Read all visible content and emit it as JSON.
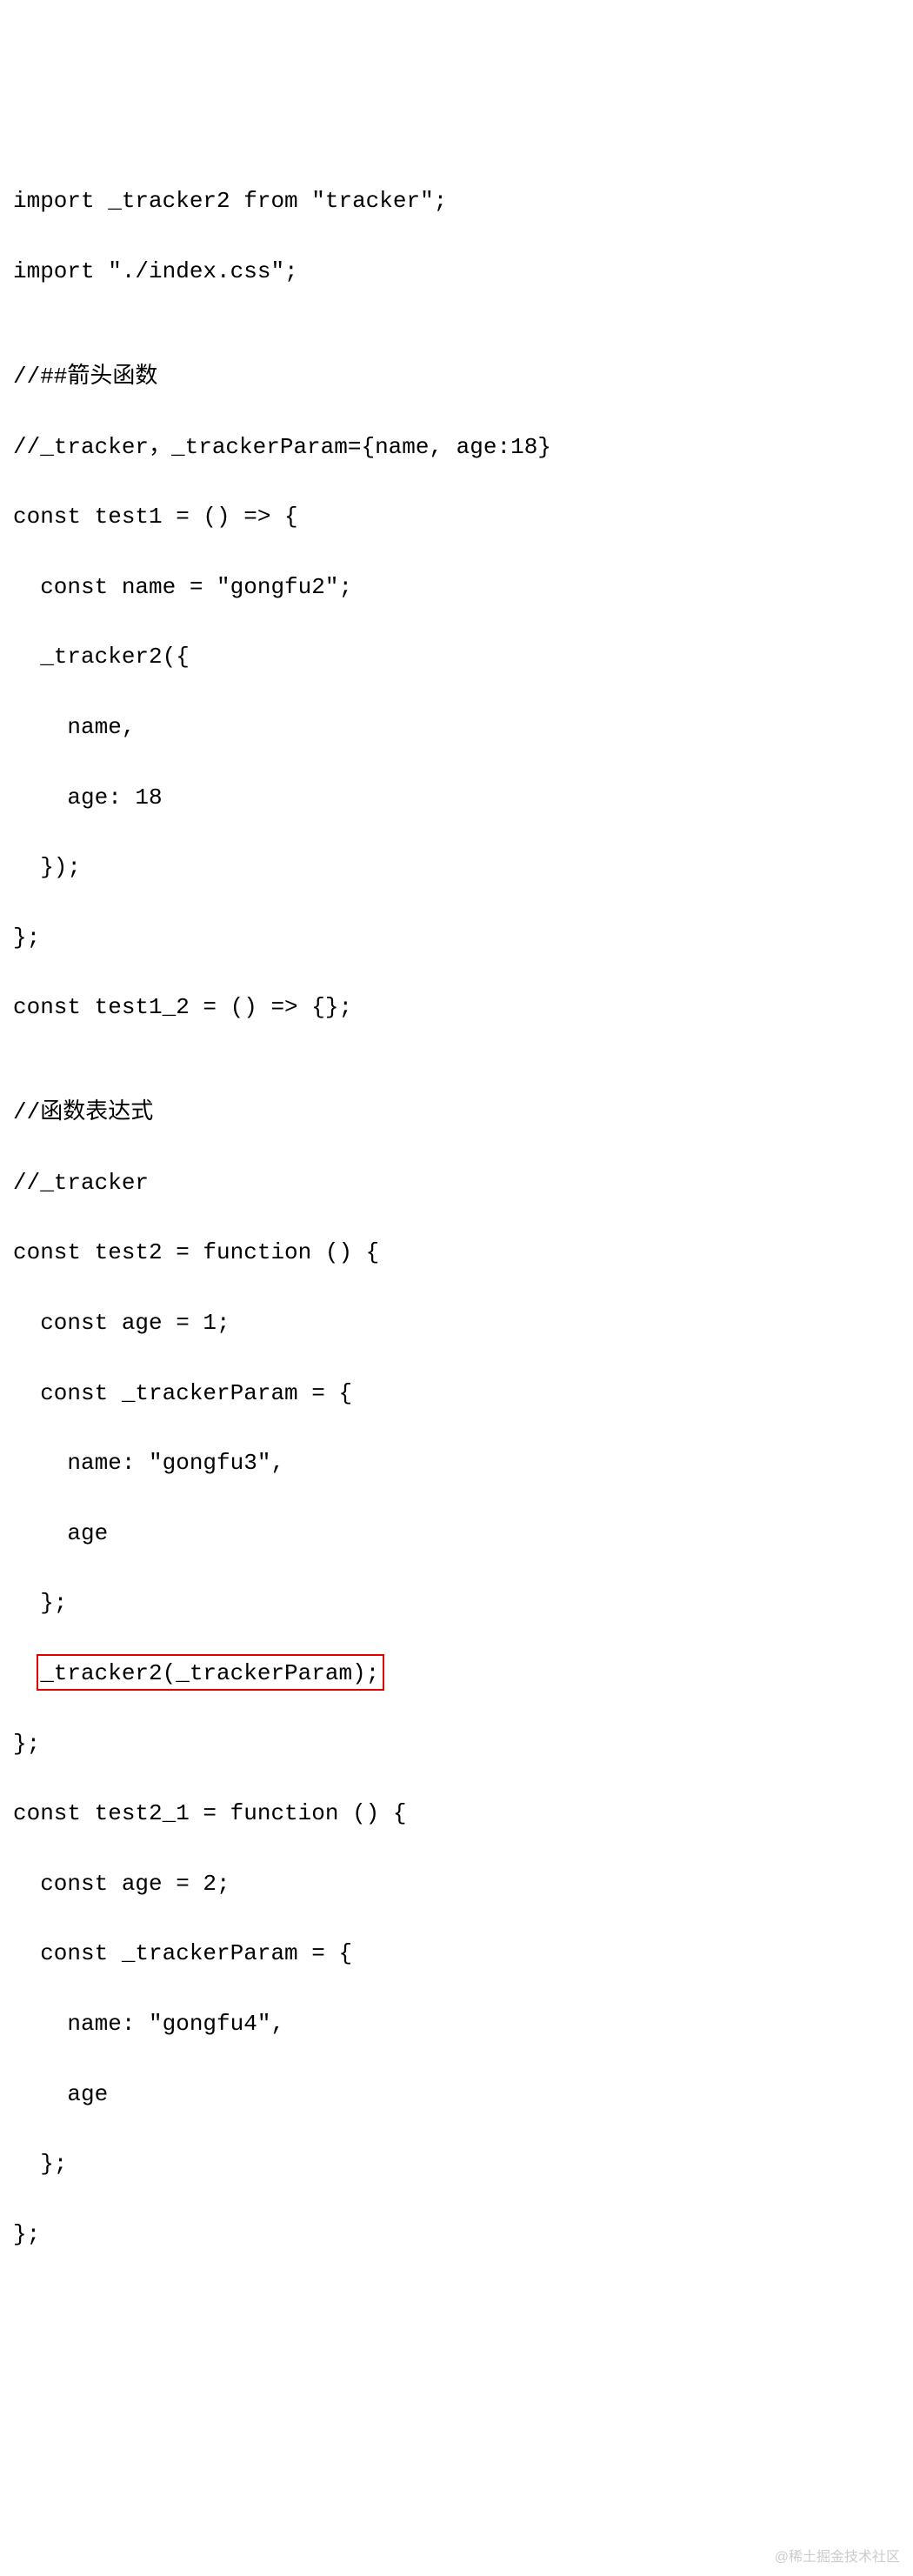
{
  "code": {
    "line1": "import _tracker2 from \"tracker\";",
    "line2": "import \"./index.css\";",
    "line3": "",
    "line4": "//##箭头函数",
    "line5": "//_tracker，_trackerParam={name, age:18}",
    "line6": "const test1 = () => {",
    "line7": "  const name = \"gongfu2\";",
    "line8": "  _tracker2({",
    "line9": "    name,",
    "line10": "    age: 18",
    "line11": "  });",
    "line12": "};",
    "line13": "const test1_2 = () => {};",
    "line14": "",
    "line15": "//函数表达式",
    "line16": "//_tracker",
    "line17": "const test2 = function () {",
    "line18": "  const age = 1;",
    "line19": "  const _trackerParam = {",
    "line20": "    name: \"gongfu3\",",
    "line21": "    age",
    "line22": "  };",
    "line23": "  _tracker2(_trackerParam);",
    "line24": "};",
    "line25": "const test2_1 = function () {",
    "line26": "  const age = 2;",
    "line27": "  const _trackerParam = {",
    "line28": "    name: \"gongfu4\",",
    "line29": "    age",
    "line30": "  };",
    "line31": "};"
  },
  "watermark": "@稀土掘金技术社区",
  "highlight": {
    "line_index": 23
  }
}
